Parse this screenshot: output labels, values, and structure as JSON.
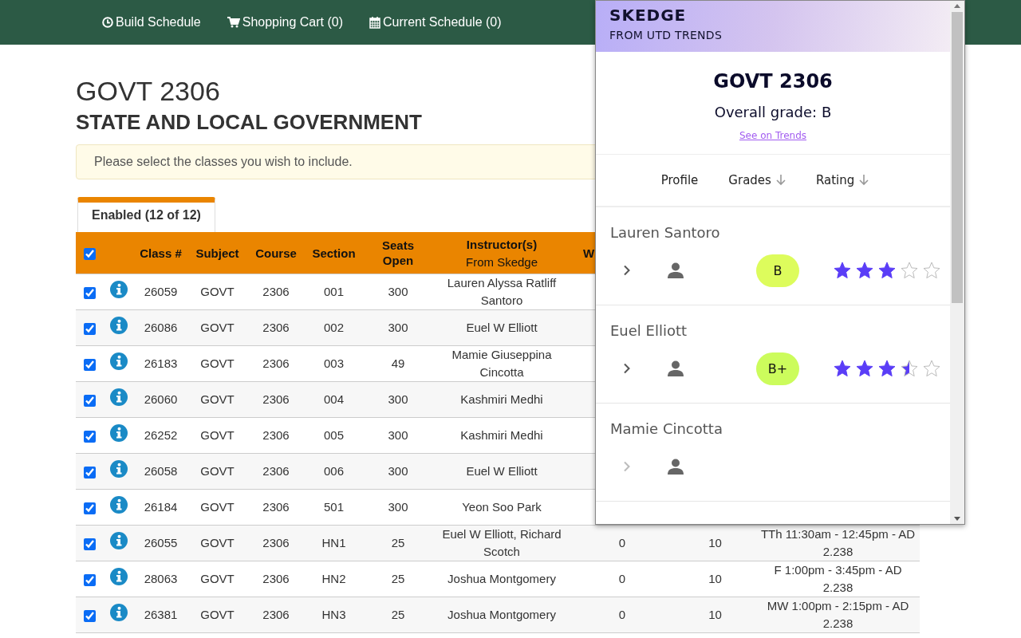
{
  "nav": [
    {
      "label": "Build Schedule"
    },
    {
      "label": "Shopping Cart (0)"
    },
    {
      "label": "Current Schedule (0)"
    }
  ],
  "page": {
    "title": "GOVT 2306",
    "subtitle": "STATE AND LOCAL GOVERNMENT",
    "notice": "Please select the classes you wish to include."
  },
  "tabs": [
    {
      "label": "Enabled (12 of 12)",
      "selected": true
    }
  ],
  "table": {
    "select_all_checked": true,
    "columns": [
      {
        "label": "Class #"
      },
      {
        "label": "Subject"
      },
      {
        "label": "Course"
      },
      {
        "label": "Section"
      },
      {
        "label": "Seats Open"
      },
      {
        "label": "Instructor(s)",
        "sublabel": "From Skedge"
      },
      {
        "label": "W"
      }
    ],
    "rows": [
      {
        "checked": true,
        "cells": [
          "26059",
          "GOVT",
          "2306",
          "001",
          "300",
          "Lauren Alyssa Ratliff Santoro"
        ]
      },
      {
        "checked": true,
        "cells": [
          "26086",
          "GOVT",
          "2306",
          "002",
          "300",
          "Euel W Elliott"
        ]
      },
      {
        "checked": true,
        "cells": [
          "26183",
          "GOVT",
          "2306",
          "003",
          "49",
          "Mamie Giuseppina Cincotta"
        ]
      },
      {
        "checked": true,
        "cells": [
          "26060",
          "GOVT",
          "2306",
          "004",
          "300",
          "Kashmiri Medhi"
        ]
      },
      {
        "checked": true,
        "cells": [
          "26252",
          "GOVT",
          "2306",
          "005",
          "300",
          "Kashmiri Medhi"
        ]
      },
      {
        "checked": true,
        "cells": [
          "26058",
          "GOVT",
          "2306",
          "006",
          "300",
          "Euel W Elliott"
        ]
      },
      {
        "checked": true,
        "cells": [
          "26184",
          "GOVT",
          "2306",
          "501",
          "300",
          "Yeon Soo Park"
        ]
      },
      {
        "checked": true,
        "cells": [
          "26055",
          "GOVT",
          "2306",
          "HN1",
          "25",
          "Euel W Elliott, Richard Scotch",
          "0",
          "10",
          "TTh 11:30am - 12:45pm - AD 2.238"
        ]
      },
      {
        "checked": true,
        "cells": [
          "28063",
          "GOVT",
          "2306",
          "HN2",
          "25",
          "Joshua Montgomery",
          "0",
          "10",
          "F 1:00pm - 3:45pm - AD 2.238"
        ]
      },
      {
        "checked": true,
        "cells": [
          "26381",
          "GOVT",
          "2306",
          "HN3",
          "25",
          "Joshua Montgomery",
          "0",
          "10",
          "MW 1:00pm - 2:15pm - AD 2.238"
        ]
      }
    ]
  },
  "popup": {
    "brand": "SKEDGE",
    "tagline": "FROM UTD TRENDS",
    "course": "GOVT 2306",
    "overall_grade": "Overall grade: B",
    "link": "See on Trends",
    "columns": [
      {
        "label": "Profile",
        "sortable": false
      },
      {
        "label": "Grades",
        "sortable": true
      },
      {
        "label": "Rating",
        "sortable": true
      }
    ],
    "professors": [
      {
        "name": "Lauren Santoro",
        "disabled": false,
        "grade": "B",
        "color": "#ddfc5c",
        "stars": 3
      },
      {
        "name": "Euel Elliott",
        "disabled": false,
        "grade": "B+",
        "color": "#ccfc5c",
        "stars": 3.5
      },
      {
        "name": "Mamie Cincotta",
        "disabled": true
      }
    ]
  }
}
